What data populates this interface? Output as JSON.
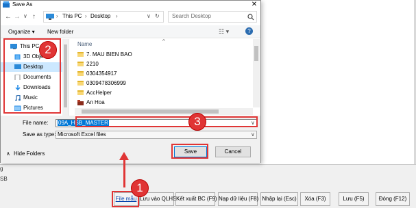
{
  "dialog": {
    "title": "Save As",
    "address_path": [
      "This PC",
      "Desktop"
    ],
    "search_placeholder": "Search Desktop",
    "organize_label": "Organize ▾",
    "new_folder_label": "New folder",
    "nav_items": [
      {
        "label": "This PC",
        "icon": "computer-icon"
      },
      {
        "label": "3D Objects",
        "icon": "cube-icon"
      },
      {
        "label": "Desktop",
        "icon": "desktop-icon",
        "selected": true
      },
      {
        "label": "Documents",
        "icon": "document-icon"
      },
      {
        "label": "Downloads",
        "icon": "download-icon"
      },
      {
        "label": "Music",
        "icon": "music-icon"
      },
      {
        "label": "Pictures",
        "icon": "picture-icon"
      }
    ],
    "column_header": "Name",
    "files": [
      {
        "name": "7. MAU BIEN BAO",
        "icon": "folder-icon"
      },
      {
        "name": "2210",
        "icon": "folder-icon"
      },
      {
        "name": "0304354917",
        "icon": "folder-icon"
      },
      {
        "name": "0309478306999",
        "icon": "folder-icon"
      },
      {
        "name": "AccHelper",
        "icon": "folder-icon"
      },
      {
        "name": "An Hoa",
        "icon": "user-folder-icon"
      }
    ],
    "filename_label": "File name:",
    "filename_value": "09A_HSB_MASTER",
    "savetype_label": "Save as type:",
    "savetype_value": "Microsoft Excel files",
    "hide_folders_label": "Hide Folders",
    "save_label": "Save",
    "cancel_label": "Cancel"
  },
  "app": {
    "side_text_1": "g",
    "side_text_2": "SB",
    "buttons": [
      {
        "label": "File mẫu"
      },
      {
        "label": "Lưu vào QLHS"
      },
      {
        "label": "Kết xuất BC (F9)"
      },
      {
        "label": "Nạp dữ liệu (F8)"
      },
      {
        "label": "Nhập lại (Esc)"
      },
      {
        "label": "Xóa (F3)"
      },
      {
        "label": "Lưu (F5)"
      },
      {
        "label": "Đóng (F12)"
      }
    ]
  },
  "callouts": [
    "1",
    "2",
    "3"
  ],
  "colors": {
    "accent": "#0078d7",
    "callout": "#e03535",
    "selected": "#cce8ff"
  }
}
